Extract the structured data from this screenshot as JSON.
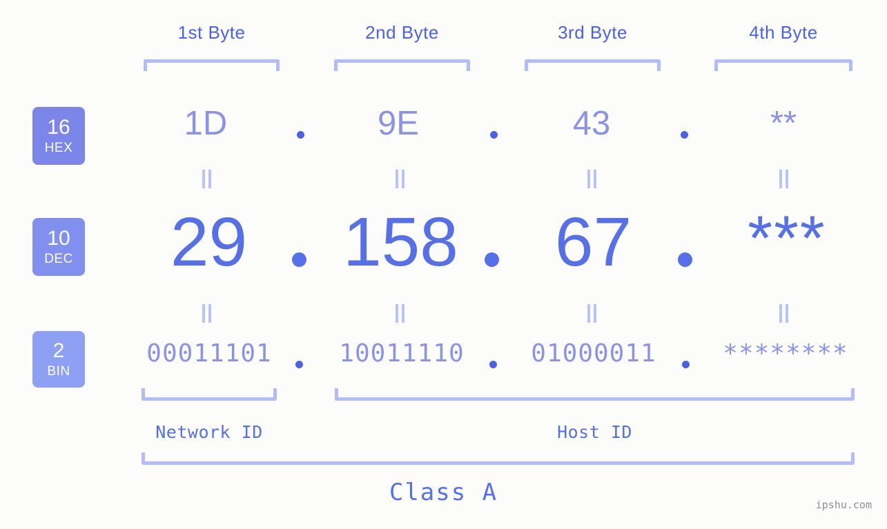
{
  "page": {
    "background_color": "#fcfdfa",
    "accent_color": "#5570e8",
    "muted_accent_color": "#8a93e8",
    "bracket_color": "#b3bcfb",
    "watermark": "ipshu.com"
  },
  "byte_headers": [
    {
      "label": "1st Byte"
    },
    {
      "label": "2nd Byte"
    },
    {
      "label": "3rd Byte"
    },
    {
      "label": "4th Byte"
    }
  ],
  "rows": {
    "hex": {
      "badge_number": "16",
      "badge_abbr": "HEX",
      "values": [
        "1D",
        "9E",
        "43",
        "**"
      ],
      "separator": "."
    },
    "dec": {
      "badge_number": "10",
      "badge_abbr": "DEC",
      "values": [
        "29",
        "158",
        "67",
        "***"
      ],
      "separator": "."
    },
    "bin": {
      "badge_number": "2",
      "badge_abbr": "BIN",
      "values": [
        "00011101",
        "10011110",
        "01000011",
        "********"
      ],
      "separator": "."
    }
  },
  "segments": [
    {
      "label": "Network ID"
    },
    {
      "label": "Host ID"
    }
  ],
  "class": {
    "label": "Class A"
  }
}
